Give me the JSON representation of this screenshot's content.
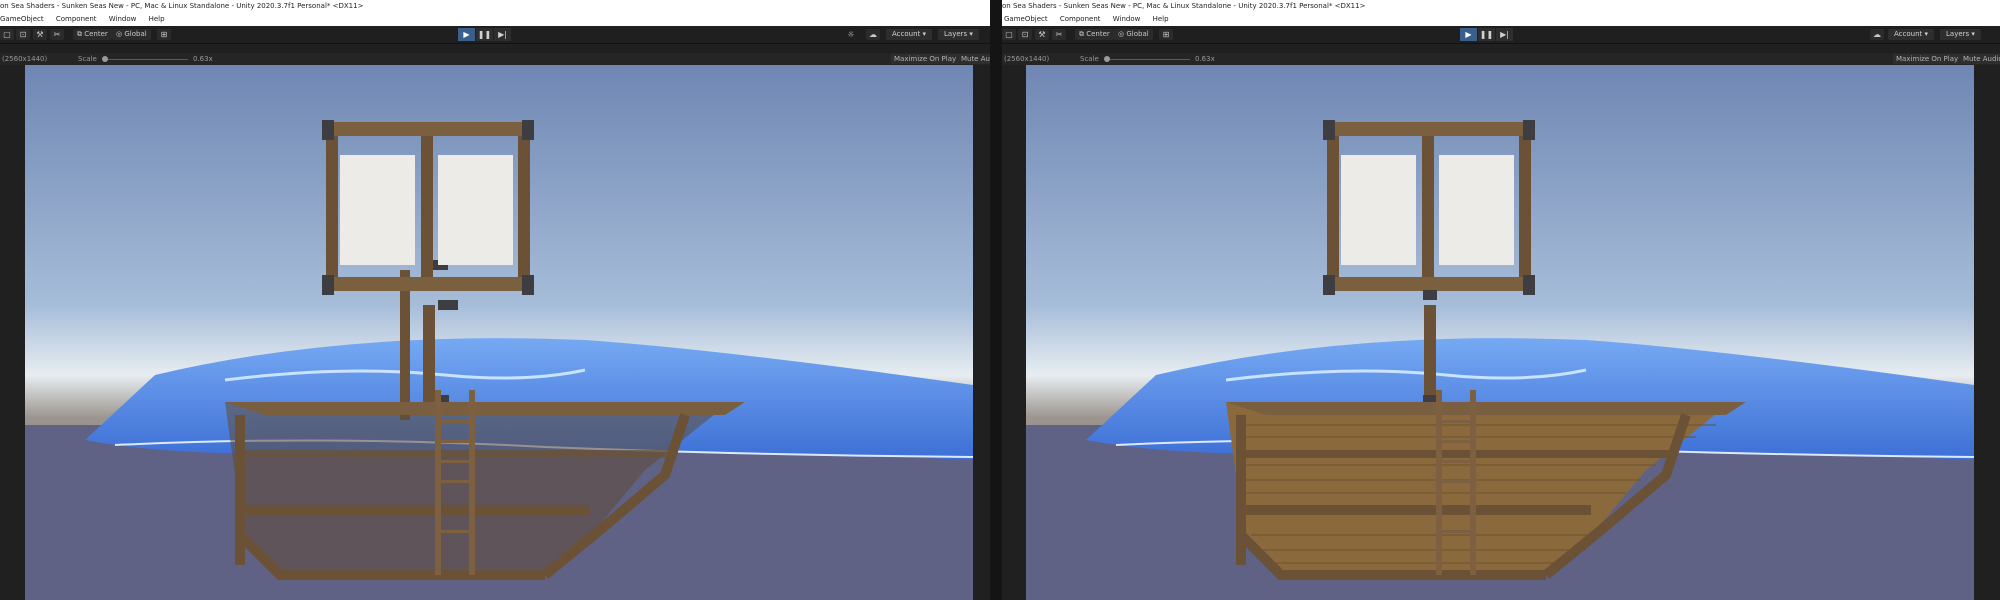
{
  "left_window": {
    "title": "on Sea Shaders - Sunken Seas New - PC, Mac & Linux Standalone - Unity 2020.3.7f1 Personal* <DX11>",
    "menu": [
      "GameObject",
      "Component",
      "Window",
      "Help"
    ],
    "toolbar": {
      "pivot_label": "Center",
      "space_label": "Global",
      "account_label": "Account",
      "layers_label": "Layers"
    },
    "game_view": {
      "resolution": "(2560x1440)",
      "scale_label": "Scale",
      "scale_value": "0.63x",
      "maximize_label": "Maximize On Play",
      "mute_label": "Mute Audio"
    }
  },
  "right_window": {
    "title": "on Sea Shaders - Sunken Seas New - PC, Mac & Linux Standalone - Unity 2020.3.7f1 Personal* <DX11>",
    "menu": [
      "GameObject",
      "Component",
      "Window",
      "Help"
    ],
    "toolbar": {
      "pivot_label": "Center",
      "space_label": "Global",
      "account_label": "Account",
      "layers_label": "Layers"
    },
    "game_view": {
      "resolution": "(2560x1440)",
      "scale_label": "Scale",
      "scale_value": "0.63x",
      "maximize_label": "Maximize On Play",
      "mute_label": "Mute Audio"
    }
  },
  "icons": {
    "play_button": "play-icon",
    "pause_button": "pause-icon",
    "step_button": "step-icon",
    "cloud_button": "cloud-icon",
    "sun_button": "sun-icon",
    "layers_button": "layers-icon"
  },
  "colors": {
    "play_active": "#3a5f8a",
    "editor_dark": "#1f1f1f",
    "water": "#4a7fe0",
    "wood": "#6b5236",
    "sail": "#ecebe8"
  }
}
